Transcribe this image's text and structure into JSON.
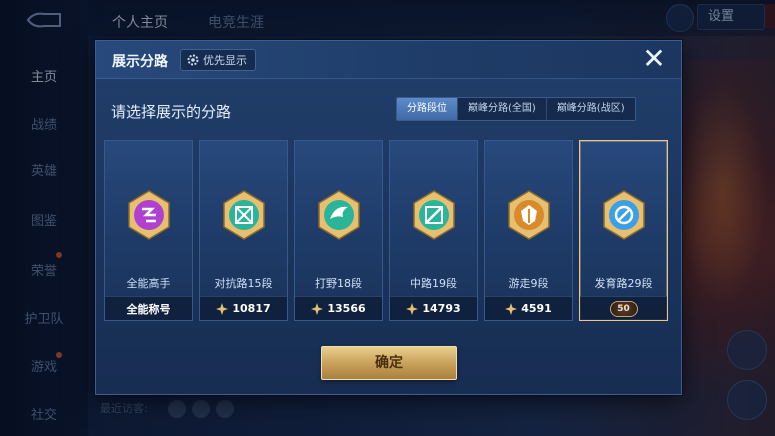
{
  "sidebar": {
    "items": [
      {
        "label": "主页",
        "active": true
      },
      {
        "label": "战绩"
      },
      {
        "label": "英雄"
      },
      {
        "label": "图鉴"
      },
      {
        "label": "荣誉"
      },
      {
        "label": "护卫队"
      },
      {
        "label": "游戏"
      },
      {
        "label": "社交"
      }
    ]
  },
  "topbar": {
    "tabs": [
      {
        "label": "个人主页",
        "active": true
      },
      {
        "label": "电竞生涯"
      }
    ],
    "settings_label": "设置"
  },
  "bottom": {
    "recent_visitors": "最近访客:"
  },
  "modal": {
    "title": "展示分路",
    "priority_label": "优先显示",
    "prompt": "请选择展示的分路",
    "segments": [
      {
        "label": "分路段位",
        "active": true
      },
      {
        "label": "巅峰分路(全国)"
      },
      {
        "label": "巅峰分路(战区)"
      }
    ],
    "cards": [
      {
        "name": "全能高手",
        "footer": "全能称号",
        "icon": "all-round-badge-icon",
        "color": "#b040d0"
      },
      {
        "name": "对抗路15段",
        "footer": "10817",
        "icon": "clash-lane-badge-icon",
        "color": "#2ab59a"
      },
      {
        "name": "打野18段",
        "footer": "13566",
        "icon": "jungle-badge-icon",
        "color": "#2ab59a"
      },
      {
        "name": "中路19段",
        "footer": "14793",
        "icon": "mid-lane-badge-icon",
        "color": "#2ab59a"
      },
      {
        "name": "游走9段",
        "footer": "4591",
        "icon": "roam-badge-icon",
        "color": "#d98a2a"
      },
      {
        "name": "发育路29段",
        "footer": "50",
        "icon": "farm-lane-badge-icon",
        "color": "#3aa0e8",
        "selected": true
      }
    ],
    "confirm_label": "确定"
  },
  "colors": {
    "accent_gold": "#c9a25b",
    "active_segment": "#4f7cbc",
    "modal_bg": "#1c3660"
  }
}
